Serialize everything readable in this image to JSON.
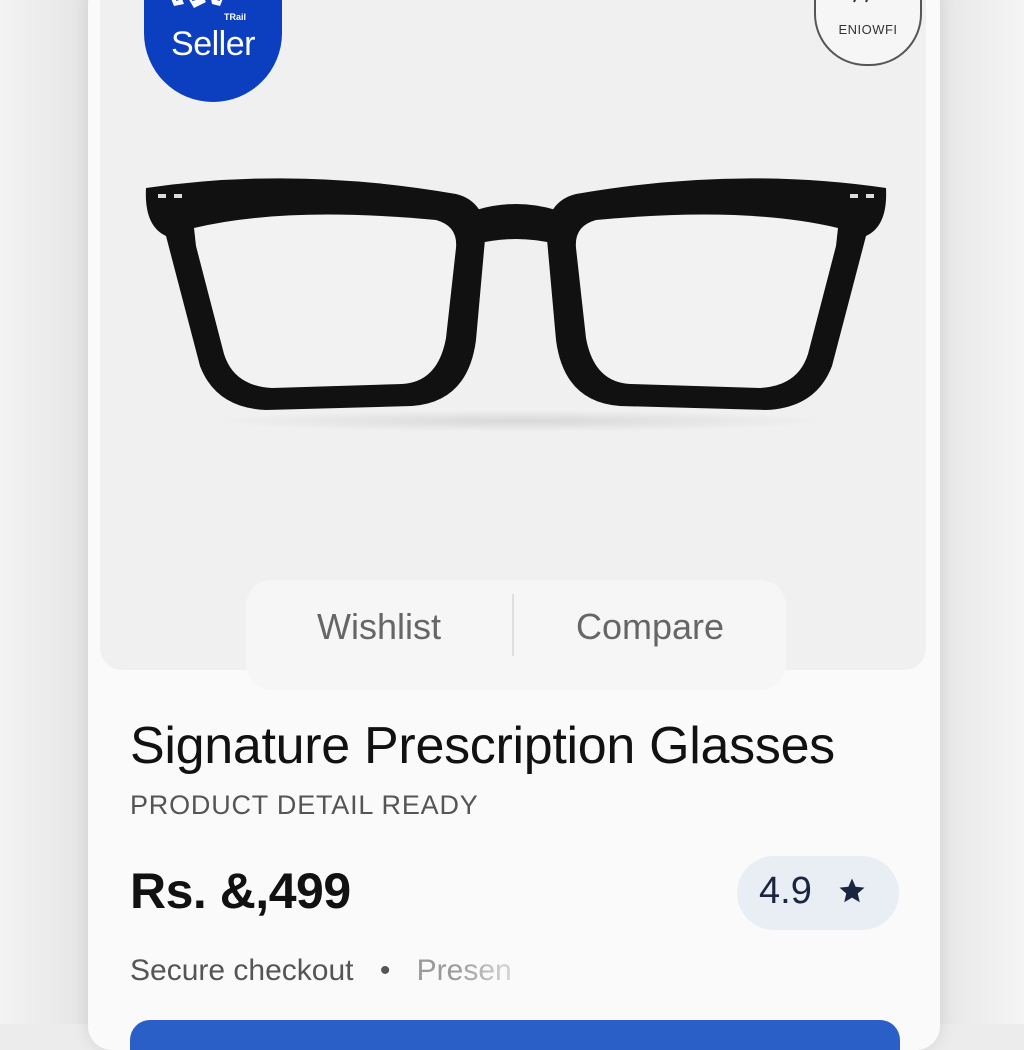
{
  "seller_badge": {
    "label": "Seller",
    "tiny_text": "TRail"
  },
  "brand_badge": {
    "label": "ENIOWFI"
  },
  "actions": {
    "wishlist": "Wishlist",
    "compare": "Compare"
  },
  "product": {
    "title": "Signature Prescription Glasses",
    "subtitle": "PRODUCT DETAIL READY",
    "price": "Rs. &,499",
    "rating": "4.9"
  },
  "meta": {
    "secure": "Secure checkout",
    "separator": "•",
    "faded": "Presen"
  },
  "colors": {
    "seller_blue": "#0c3fbf",
    "cta_blue": "#2a5fc7",
    "rating_bg": "#e9eef5"
  },
  "icons": {
    "rating": "star-icon",
    "emblem": "seller-emblem-icon"
  }
}
